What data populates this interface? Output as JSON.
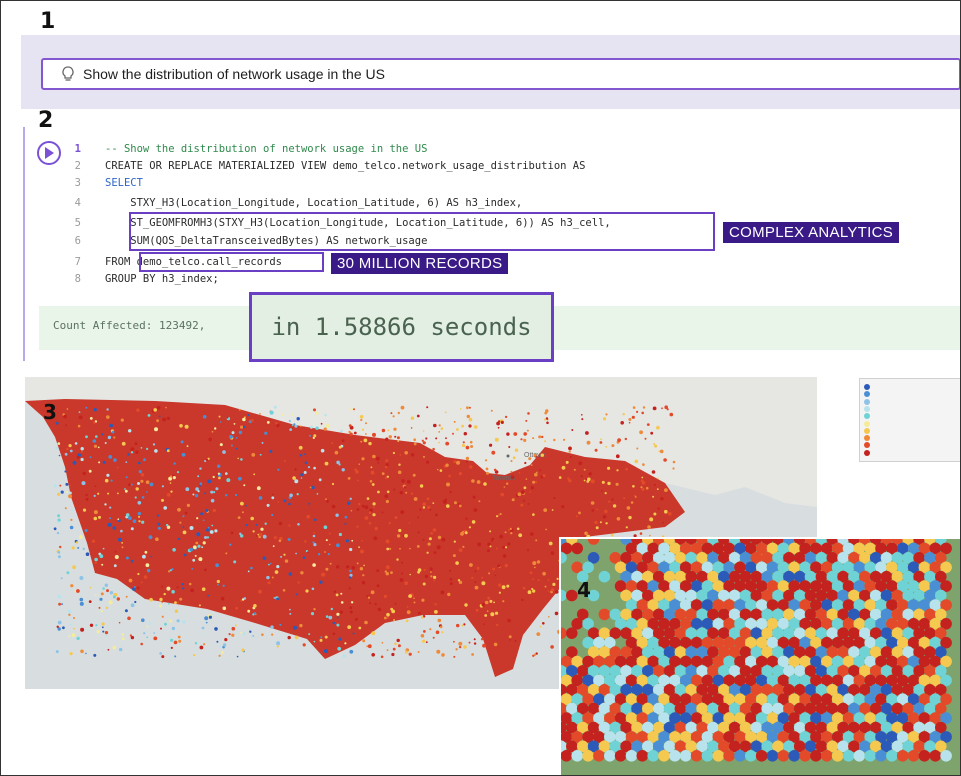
{
  "steps": {
    "one": "1",
    "two": "2",
    "three": "3",
    "four": "4"
  },
  "prompt": {
    "value": "Show the distribution of network usage in the US",
    "icon": "lightbulb-icon"
  },
  "code": {
    "lines": [
      {
        "n": "1",
        "text": "-- Show the distribution of network usage in the US"
      },
      {
        "n": "2",
        "text": "CREATE OR REPLACE MATERIALIZED VIEW demo_telco.network_usage_distribution AS"
      },
      {
        "n": "3",
        "text": "SELECT"
      },
      {
        "n": "4",
        "text": "    STXY_H3(Location_Longitude, Location_Latitude, 6) AS h3_index,"
      },
      {
        "n": "5",
        "text": "    ST_GEOMFROMH3(STXY_H3(Location_Longitude, Location_Latitude, 6)) AS h3_cell,"
      },
      {
        "n": "6",
        "text": "    SUM(QOS_DeltaTransceivedBytes) AS network_usage"
      },
      {
        "n": "7",
        "text": "FROM demo_telco.call_records"
      },
      {
        "n": "8",
        "text": "GROUP BY h3_index;"
      }
    ]
  },
  "annotations": {
    "complex": "COMPLEX ANALYTICS",
    "records": "30 MILLION RECORDS"
  },
  "result": {
    "count": "Count Affected: 123492,",
    "time": "in 1.58866 seconds"
  },
  "map": {
    "labels": {
      "ottawa": "Ottawa",
      "toronto": "Toronto"
    },
    "legend_colors": [
      "#2c5ab8",
      "#4a8fd4",
      "#8ec3e8",
      "#b8e3ec",
      "#6fd3d6",
      "#f4ec9a",
      "#f5c850",
      "#ee8a3a",
      "#e34a2a",
      "#c4221e"
    ]
  }
}
